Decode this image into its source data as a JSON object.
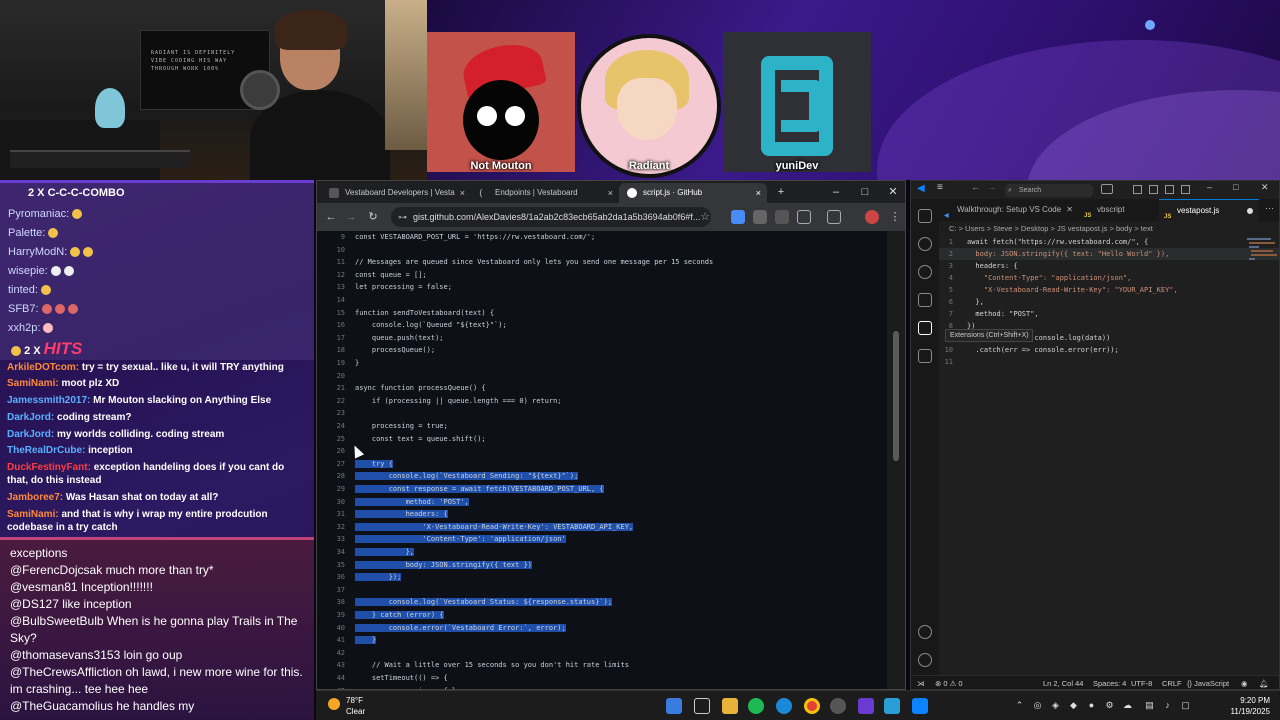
{
  "stream": {
    "webcam_sign": "RADIANT IS DEFINITELY\nVIBE CODING HIS WAY\nTHROUGH WORK 100%",
    "guests": [
      {
        "name": "Not Mouton"
      },
      {
        "name": "Radiant"
      },
      {
        "name": "yuniDev"
      }
    ]
  },
  "chat": {
    "combo_header": "2 X C-C-C-COMBO",
    "combo_users": [
      "Pyromaniac:",
      "Palette:",
      "HarryModN:",
      "wisepie:",
      "tinted:",
      "SFB7:",
      "xxh2p:"
    ],
    "hits_count": "2 X",
    "hits_label": "HITS",
    "messages": [
      {
        "user": "ArkileDOTcom:",
        "text": "try = try sexual.. like u, it will TRY anything"
      },
      {
        "user": "SamiNami:",
        "text": "moot plz XD"
      },
      {
        "user": "Jamessmith2017:",
        "text": "Mr Mouton slacking on Anything Else"
      },
      {
        "user": "DarkJord:",
        "text": "coding stream?"
      },
      {
        "user": "DarkJord:",
        "text": "my worlds colliding. coding stream"
      },
      {
        "user": "TheRealDrCube:",
        "text": "inception"
      },
      {
        "user": "DuckFestinyFant:",
        "text": "exception handeling does if you cant do that, do this instead"
      },
      {
        "user": "Jamboree7:",
        "text": "Was Hasan shat on today at all?"
      },
      {
        "user": "SamiNami:",
        "text": "and that is why i wrap my entire prodcution codebase in a try catch"
      }
    ],
    "bottom_messages": [
      {
        "user": "",
        "text": "exceptions"
      },
      {
        "user": "@FerencDojcsak",
        "text": "much more than try*"
      },
      {
        "user": "@vesman81",
        "text": "Inception!!!!!!!"
      },
      {
        "user": "@DS127",
        "text": "like inception"
      },
      {
        "user": "@BulbSweetBulb",
        "text": "When is he gonna play Trails in The Sky?"
      },
      {
        "user": "@thomasevans3153",
        "text": "loin go oup"
      },
      {
        "user": "@TheCrewsAffliction",
        "text": "oh lawd, i new more wine for this. im crashing... tee hee hee"
      },
      {
        "user": "@TheGuacamolius",
        "text": "he handles my"
      }
    ]
  },
  "browser": {
    "tabs": [
      {
        "label": "Vestaboard Developers | Vesta",
        "close": "×"
      },
      {
        "label": "Endpoints | Vestaboard",
        "close": "×"
      },
      {
        "label": "script.js · GitHub",
        "close": "×"
      }
    ],
    "new_tab": "+",
    "window_controls": {
      "min": "–",
      "max": "□",
      "close": "✕"
    },
    "url": "gist.github.com/AlexDavies8/1a2ab2c83ecb65ab2da1a5b3694ab0f6#f...",
    "code_lines": [
      {
        "n": "9",
        "t": "const VESTABOARD_POST_URL = 'https://rw.vestaboard.com/';"
      },
      {
        "n": "10",
        "t": ""
      },
      {
        "n": "11",
        "t": "// Messages are queued since Vestaboard only lets you send one message per 15 seconds"
      },
      {
        "n": "12",
        "t": "const queue = [];"
      },
      {
        "n": "13",
        "t": "let processing = false;"
      },
      {
        "n": "14",
        "t": ""
      },
      {
        "n": "15",
        "t": "function sendToVestaboard(text) {"
      },
      {
        "n": "16",
        "t": "    console.log(`Queued \"${text}\"`);"
      },
      {
        "n": "17",
        "t": "    queue.push(text);"
      },
      {
        "n": "18",
        "t": "    processQueue();"
      },
      {
        "n": "19",
        "t": "}"
      },
      {
        "n": "20",
        "t": ""
      },
      {
        "n": "21",
        "t": "async function processQueue() {"
      },
      {
        "n": "22",
        "t": "    if (processing || queue.length === 0) return;"
      },
      {
        "n": "23",
        "t": ""
      },
      {
        "n": "24",
        "t": "    processing = true;"
      },
      {
        "n": "25",
        "t": "    const text = queue.shift();"
      },
      {
        "n": "26",
        "t": ""
      },
      {
        "n": "27",
        "t": "    try {"
      },
      {
        "n": "28",
        "t": "        console.log(`Vestaboard Sending: \"${text}\"`);"
      },
      {
        "n": "29",
        "t": "        const response = await fetch(VESTABOARD_POST_URL, {"
      },
      {
        "n": "30",
        "t": "            method: 'POST',"
      },
      {
        "n": "31",
        "t": "            headers: {"
      },
      {
        "n": "32",
        "t": "                'X-Vestaboard-Read-Write-Key': VESTABOARD_API_KEY,"
      },
      {
        "n": "33",
        "t": "                'Content-Type': 'application/json'"
      },
      {
        "n": "34",
        "t": "            },"
      },
      {
        "n": "35",
        "t": "            body: JSON.stringify({ text })"
      },
      {
        "n": "36",
        "t": "        });"
      },
      {
        "n": "37",
        "t": ""
      },
      {
        "n": "38",
        "t": "        console.log(`Vestaboard Status: ${response.status}`);"
      },
      {
        "n": "39",
        "t": "    } catch (error) {"
      },
      {
        "n": "40",
        "t": "        console.error(`Vestaboard Error:`, error);"
      },
      {
        "n": "41",
        "t": "    }"
      },
      {
        "n": "42",
        "t": ""
      },
      {
        "n": "43",
        "t": "    // Wait a little over 15 seconds so you don't hit rate limits"
      },
      {
        "n": "44",
        "t": "    setTimeout(() => {"
      },
      {
        "n": "45",
        "t": "        processing = false;"
      }
    ],
    "selected_from": "26",
    "selected_to": "41"
  },
  "vscode": {
    "search": "Search",
    "tabs": [
      {
        "label": "Walkthrough: Setup VS Code",
        "icon": ""
      },
      {
        "label": "vbscript",
        "icon": "JS"
      },
      {
        "label": "vestapost.js",
        "icon": "JS"
      }
    ],
    "breadcrumb": "C: > Users > Steve > Desktop > JS vestapost.js > body > text",
    "code_lines": [
      {
        "n": "1",
        "t": "await fetch(\"https://rw.vestaboard.com/\", {"
      },
      {
        "n": "2",
        "t": "  body: JSON.stringify({ text: \"Hello World\" }),"
      },
      {
        "n": "3",
        "t": "  headers: {"
      },
      {
        "n": "4",
        "t": "    \"Content-Type\": \"application/json\","
      },
      {
        "n": "5",
        "t": "    \"X-Vestaboard-Read-Write-Key\": \"YOUR_API_KEY\","
      },
      {
        "n": "6",
        "t": "  },"
      },
      {
        "n": "7",
        "t": "  method: \"POST\","
      },
      {
        "n": "8",
        "t": "})"
      },
      {
        "n": "9",
        "t": "  .then(data => console.log(data))"
      },
      {
        "n": "10",
        "t": "  .catch(err => console.error(err));"
      },
      {
        "n": "11",
        "t": ""
      }
    ],
    "tooltip": "Extensions (Ctrl+Shift+X)",
    "status": {
      "errors": "⊗ 0 ⚠ 0",
      "position": "Ln 2, Col 44",
      "spaces": "Spaces: 4",
      "encoding": "UTF-8",
      "eol": "CRLF",
      "language": "{} JavaScript"
    }
  },
  "taskbar": {
    "temp": "78°F",
    "condition": "Clear",
    "time": "9:20 PM",
    "date": "11/19/2025"
  },
  "colors": {
    "selection": "#1f4fa8",
    "chat_accent": "#6a3bd1",
    "vscode_accent": "#0078d4"
  }
}
